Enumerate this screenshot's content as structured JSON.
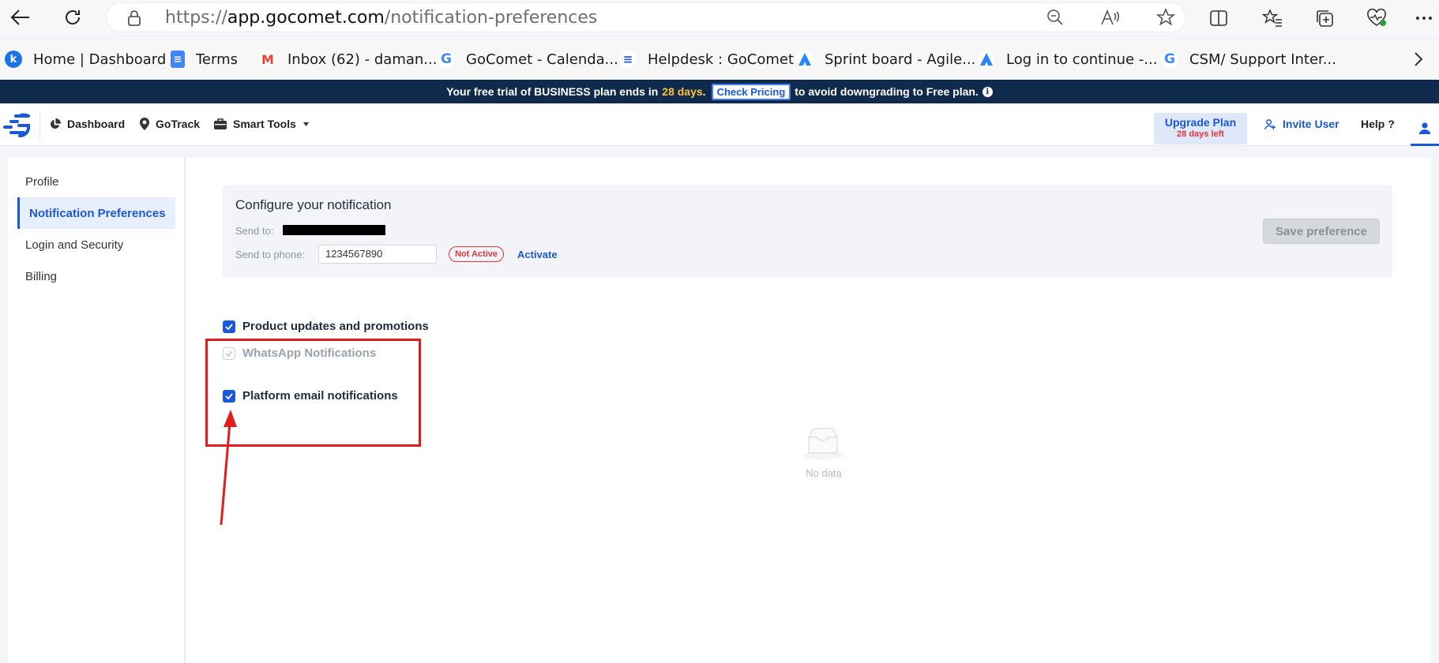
{
  "browser": {
    "url_prefix": "https://",
    "url_domain": "app.gocomet.com",
    "url_path": "/notification-preferences"
  },
  "bookmarks": [
    {
      "label": "Home | Dashboard",
      "icon": "k-icon",
      "color": "#1a73e8"
    },
    {
      "label": "Terms",
      "icon": "docs-icon",
      "color": "#4285f4"
    },
    {
      "label": "Inbox (62) - daman...",
      "icon": "gmail-icon",
      "color": "#ea4335"
    },
    {
      "label": "GoComet - Calenda...",
      "icon": "google-icon",
      "color": "#4285f4"
    },
    {
      "label": "Helpdesk : GoComet",
      "icon": "gocomet-icon",
      "color": "#1a58d9"
    },
    {
      "label": "Sprint board - Agile...",
      "icon": "atlassian-icon",
      "color": "#2684ff"
    },
    {
      "label": "Log in to continue -...",
      "icon": "atlassian-icon",
      "color": "#2684ff"
    },
    {
      "label": "CSM/ Support Inter...",
      "icon": "google-icon",
      "color": "#4285f4"
    }
  ],
  "trial": {
    "text_before": "Your free trial of BUSINESS plan ends in",
    "days": "28 days",
    "dot": ".",
    "check_pricing": "Check Pricing",
    "text_after": "to avoid downgrading to Free plan."
  },
  "header": {
    "nav": [
      {
        "label": "Dashboard",
        "icon": "pie-chart-icon"
      },
      {
        "label": "GoTrack",
        "icon": "location-pin-icon"
      },
      {
        "label": "Smart Tools",
        "icon": "toolbox-icon"
      }
    ],
    "upgrade_title": "Upgrade Plan",
    "upgrade_sub": "28 days left",
    "invite_user": "Invite User",
    "help": "Help",
    "help_mark": "?"
  },
  "sidebar": {
    "items": [
      {
        "label": "Profile",
        "active": false
      },
      {
        "label": "Notification Preferences",
        "active": true
      },
      {
        "label": "Login and Security",
        "active": false
      },
      {
        "label": "Billing",
        "active": false
      }
    ]
  },
  "config": {
    "title": "Configure your notification",
    "send_to_label": "Send to:",
    "send_to_phone_label": "Send to phone:",
    "phone_value": "1234567890",
    "status": "Not Active",
    "activate": "Activate",
    "save": "Save preference"
  },
  "options": [
    {
      "label": "Product updates and promotions",
      "checked": true,
      "disabled": false
    },
    {
      "label": "WhatsApp Notifications",
      "checked": true,
      "disabled": true
    },
    {
      "label": "Platform email notifications",
      "checked": true,
      "disabled": false
    }
  ],
  "empty_state": {
    "text": "No data"
  },
  "colors": {
    "accent": "#1a58d9",
    "banner": "#0f2a4d",
    "warning": "#e0353b",
    "annotation": "#e21d1d"
  }
}
